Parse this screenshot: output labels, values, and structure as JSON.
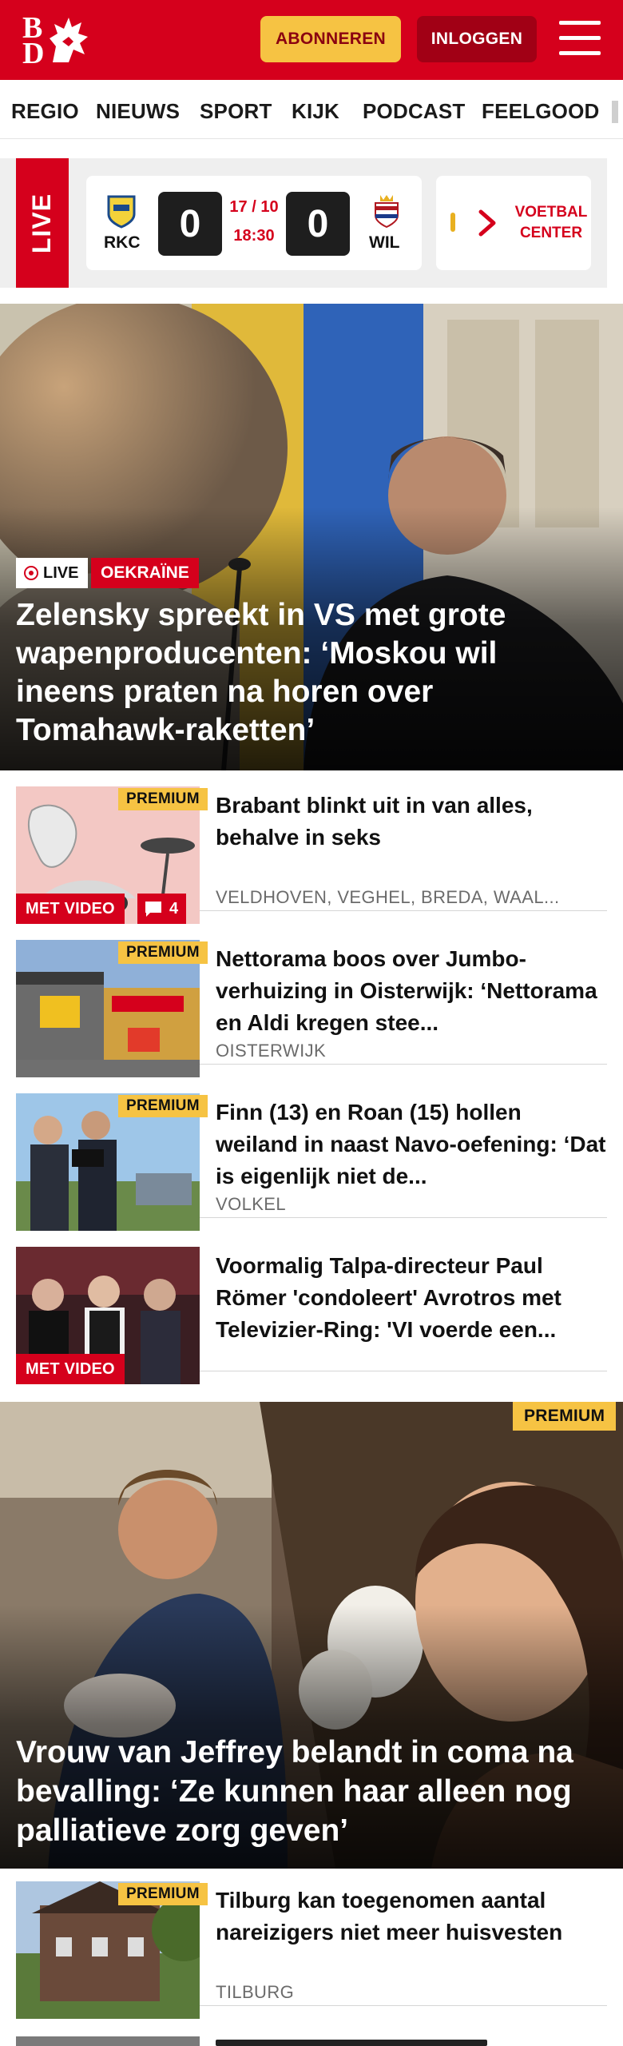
{
  "header": {
    "logo_letters": [
      "B",
      "D"
    ],
    "subscribe_label": "ABONNEREN",
    "login_label": "INLOGGEN",
    "menu_icon": "hamburger-icon",
    "brand_color": "#d5001c",
    "subscribe_color": "#f6c343"
  },
  "nav": {
    "items": [
      "REGIO",
      "NIEUWS",
      "SPORT",
      "KIJK",
      "PODCAST",
      "FEELGOOD"
    ]
  },
  "live": {
    "label": "LIVE",
    "match": {
      "home_team": "RKC",
      "away_team": "WIL",
      "home_score": "0",
      "away_score": "0",
      "date": "17 / 10",
      "time": "18:30"
    },
    "voetbal_center_label": "VOETBAL\nCENTER"
  },
  "hero": {
    "live_tag": "LIVE",
    "category": "OEKRAÏNE",
    "title": "Zelensky spreekt in VS met grote wapenproducenten: ‘Moskou wil ineens praten na horen over Tomahawk-raketten’"
  },
  "articles": [
    {
      "title": "Brabant blinkt uit in van alles, behalve in seks",
      "location": "VELDHOVEN, VEGHEL, BREDA, WAAL...",
      "premium": "PREMIUM",
      "video": "MET VIDEO",
      "comments": "4"
    },
    {
      "title": "Nettorama boos over Jumbo-verhuizing in Oisterwijk: ‘Nettorama en Aldi kregen stee...",
      "location": "OISTERWIJK",
      "premium": "PREMIUM"
    },
    {
      "title": "Finn (13) en Roan (15) hollen weiland in naast Navo-oefening: ‘Dat is eigenlijk niet de...",
      "location": "VOLKEL",
      "premium": "PREMIUM"
    },
    {
      "title": "Voormalig Talpa-directeur Paul Römer 'condoleert' Avrotros met Televizier-Ring: 'VI voerde een...",
      "video": "MET VIDEO"
    }
  ],
  "hero2": {
    "premium": "PREMIUM",
    "title": "Vrouw van Jeffrey belandt in coma na bevalling: ‘Ze kunnen haar alleen nog palliatieve zorg geven’"
  },
  "article_last": {
    "title": "Tilburg kan toegenomen aantal nareizigers niet meer huisvesten",
    "location": "TILBURG",
    "premium": "PREMIUM"
  }
}
